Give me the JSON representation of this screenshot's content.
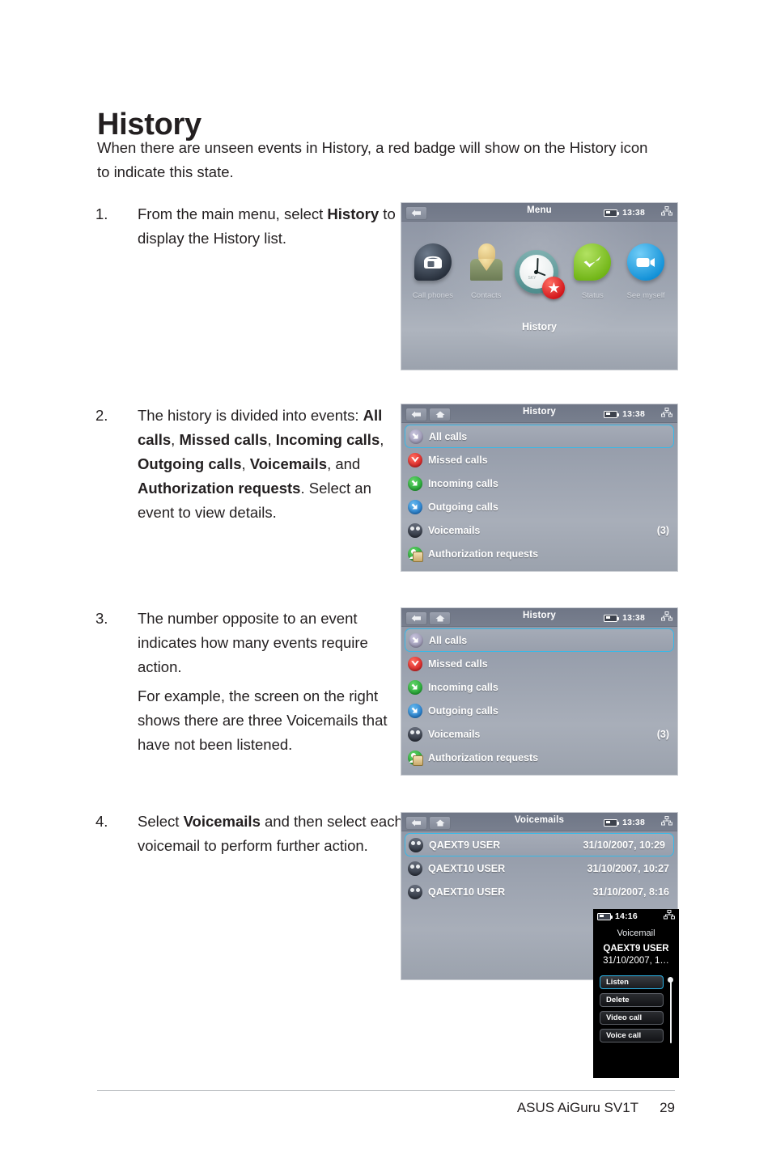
{
  "document": {
    "title": "History",
    "intro": "When there are unseen events in History, a red badge will show on the History icon to indicate this state.",
    "footer": {
      "product": "ASUS AiGuru SV1T",
      "page_number": "29"
    }
  },
  "steps": [
    {
      "number": "1.",
      "lines": [
        {
          "parts": [
            {
              "t": "From the main menu, select ",
              "b": false
            },
            {
              "t": "History",
              "b": true
            },
            {
              "t": " to display the History list.",
              "b": false
            }
          ]
        }
      ]
    },
    {
      "number": "2.",
      "lines": [
        {
          "parts": [
            {
              "t": "The history is divided into events: ",
              "b": false
            },
            {
              "t": "All calls",
              "b": true
            },
            {
              "t": ", ",
              "b": false
            },
            {
              "t": "Missed calls",
              "b": true
            },
            {
              "t": ", ",
              "b": false
            },
            {
              "t": "Incoming calls",
              "b": true
            },
            {
              "t": ", ",
              "b": false
            },
            {
              "t": "Outgoing calls",
              "b": true
            },
            {
              "t": ", ",
              "b": false
            },
            {
              "t": "Voicemails",
              "b": true
            },
            {
              "t": ", and ",
              "b": false
            },
            {
              "t": "Authorization requests",
              "b": true
            },
            {
              "t": ". Select an event to view details.",
              "b": false
            }
          ]
        }
      ]
    },
    {
      "number": "3.",
      "lines": [
        {
          "parts": [
            {
              "t": "The number opposite to an event indicates how many events require action.",
              "b": false
            }
          ]
        },
        {
          "parts": [
            {
              "t": "For example, the screen on the right shows there are three Voicemails that have not been listened.",
              "b": false
            }
          ]
        }
      ]
    },
    {
      "number": "4.",
      "lines": [
        {
          "parts": [
            {
              "t": "Select ",
              "b": false
            },
            {
              "t": "Voicemails",
              "b": true
            },
            {
              "t": " and then select each voicemail to perform further action.",
              "b": false
            }
          ]
        }
      ]
    }
  ],
  "screens": {
    "menu": {
      "statusbar": {
        "title": "Menu",
        "time": "13:38",
        "battery_icon": "battery-icon",
        "network_icon": "network-icon",
        "back_icon": "back-arrow-icon"
      },
      "items": [
        {
          "label": "Call phones",
          "icon": "phone-icon",
          "active": false
        },
        {
          "label": "Contacts",
          "icon": "contact-person-icon",
          "active": false
        },
        {
          "label": "History",
          "icon": "clock-icon",
          "badge": "star-badge-icon",
          "active": true
        },
        {
          "label": "Status",
          "icon": "check-icon",
          "active": false
        },
        {
          "label": "See myself",
          "icon": "video-camera-icon",
          "active": false
        }
      ]
    },
    "history": {
      "statusbar": {
        "title": "History",
        "time": "13:38",
        "battery_icon": "battery-icon",
        "network_icon": "network-icon",
        "back_icon": "back-arrow-icon",
        "home_icon": "home-icon"
      },
      "rows": [
        {
          "label": "All calls",
          "value": "",
          "icon": "all-calls-icon",
          "selected": true
        },
        {
          "label": "Missed calls",
          "value": "",
          "icon": "missed-calls-icon",
          "selected": false
        },
        {
          "label": "Incoming calls",
          "value": "",
          "icon": "incoming-calls-icon",
          "selected": false
        },
        {
          "label": "Outgoing calls",
          "value": "",
          "icon": "outgoing-calls-icon",
          "selected": false
        },
        {
          "label": "Voicemails",
          "value": "(3)",
          "icon": "voicemail-icon",
          "selected": false
        },
        {
          "label": "Authorization requests",
          "value": "",
          "icon": "authorization-requests-icon",
          "selected": false
        }
      ]
    },
    "voicemails": {
      "statusbar": {
        "title": "Voicemails",
        "time": "13:38",
        "battery_icon": "battery-icon",
        "network_icon": "network-icon",
        "back_icon": "back-arrow-icon",
        "home_icon": "home-icon"
      },
      "rows": [
        {
          "label": "QAEXT9 USER",
          "value": "31/10/2007, 10:29",
          "icon": "voicemail-icon",
          "selected": true
        },
        {
          "label": "QAEXT10 USER",
          "value": "31/10/2007, 10:27",
          "icon": "voicemail-icon",
          "selected": false
        },
        {
          "label": "QAEXT10 USER",
          "value": "31/10/2007, 8:16",
          "icon": "voicemail-icon",
          "selected": false
        }
      ]
    },
    "voicemail_popup": {
      "statusbar": {
        "time": "14:16",
        "battery_icon": "battery-icon",
        "network_icon": "network-icon"
      },
      "title": "Voicemail",
      "user": "QAEXT9 USER",
      "date": "31/10/2007, 1…",
      "buttons": [
        {
          "label": "Listen",
          "selected": true
        },
        {
          "label": "Delete",
          "selected": false
        },
        {
          "label": "Video call",
          "selected": false
        },
        {
          "label": "Voice call",
          "selected": false
        }
      ]
    }
  },
  "colors": {
    "selection_outline": "#37b9e8",
    "badge_red": "#cf1016",
    "status_green": "#6eb313",
    "video_blue": "#0d8ed6"
  }
}
